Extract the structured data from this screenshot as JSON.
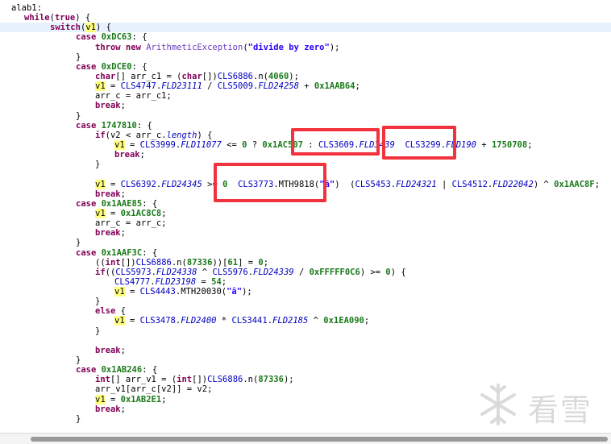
{
  "code_lines": [
    {
      "indent": 1,
      "tokens": [
        [
          "plain",
          "alab1:"
        ]
      ]
    },
    {
      "indent": 3,
      "tokens": [
        [
          "kw",
          "while"
        ],
        [
          "plain",
          "("
        ],
        [
          "kw",
          "true"
        ],
        [
          "plain",
          ") {"
        ]
      ]
    },
    {
      "indent": 7,
      "highlight": true,
      "tokens": [
        [
          "kw",
          "switch"
        ],
        [
          "plain",
          "("
        ],
        [
          "var",
          "v1"
        ],
        [
          "plain",
          ") {"
        ]
      ]
    },
    {
      "indent": 11,
      "tokens": [
        [
          "kw",
          "case "
        ],
        [
          "num",
          "0xDC63"
        ],
        [
          "plain",
          ": {"
        ]
      ]
    },
    {
      "indent": 14,
      "tokens": [
        [
          "kw",
          "throw new "
        ],
        [
          "exc",
          "ArithmeticException"
        ],
        [
          "plain",
          "("
        ],
        [
          "str",
          "\"divide by zero\""
        ],
        [
          "plain",
          ");"
        ]
      ]
    },
    {
      "indent": 11,
      "tokens": [
        [
          "plain",
          "}"
        ]
      ]
    },
    {
      "indent": 11,
      "tokens": [
        [
          "kw",
          "case "
        ],
        [
          "num",
          "0xDCE0"
        ],
        [
          "plain",
          ": {"
        ]
      ]
    },
    {
      "indent": 14,
      "tokens": [
        [
          "kw",
          "char"
        ],
        [
          "plain",
          "[] arr_c1 = ("
        ],
        [
          "kw",
          "char"
        ],
        [
          "plain",
          "[])"
        ],
        [
          "cls",
          "CLS6886"
        ],
        [
          "plain",
          ".n("
        ],
        [
          "num",
          "4060"
        ],
        [
          "plain",
          ");"
        ]
      ]
    },
    {
      "indent": 14,
      "tokens": [
        [
          "var",
          "v1"
        ],
        [
          "plain",
          " = "
        ],
        [
          "cls",
          "CLS4747"
        ],
        [
          "plain",
          "."
        ],
        [
          "fld",
          "FLD23111"
        ],
        [
          "plain",
          " / "
        ],
        [
          "cls",
          "CLS5009"
        ],
        [
          "plain",
          "."
        ],
        [
          "fld",
          "FLD24258"
        ],
        [
          "plain",
          " + "
        ],
        [
          "num",
          "0x1AAB64"
        ],
        [
          "plain",
          ";"
        ]
      ]
    },
    {
      "indent": 14,
      "tokens": [
        [
          "plain",
          "arr_c = arr_c1;"
        ]
      ]
    },
    {
      "indent": 14,
      "tokens": [
        [
          "kw",
          "break"
        ],
        [
          "plain",
          ";"
        ]
      ]
    },
    {
      "indent": 11,
      "tokens": [
        [
          "plain",
          "}"
        ]
      ]
    },
    {
      "indent": 11,
      "tokens": [
        [
          "kw",
          "case "
        ],
        [
          "num",
          "1747810"
        ],
        [
          "plain",
          ": {"
        ]
      ]
    },
    {
      "indent": 14,
      "tokens": [
        [
          "kw",
          "if"
        ],
        [
          "plain",
          "(v2 < arr_c."
        ],
        [
          "fld",
          "length"
        ],
        [
          "plain",
          ") {"
        ]
      ]
    },
    {
      "indent": 17,
      "tokens": [
        [
          "var",
          "v1"
        ],
        [
          "plain",
          " = "
        ],
        [
          "cls",
          "CLS3999"
        ],
        [
          "plain",
          "."
        ],
        [
          "fld",
          "FLD11077"
        ],
        [
          "plain",
          " <= "
        ],
        [
          "num",
          "0"
        ],
        [
          "plain",
          " ? "
        ],
        [
          "num",
          "0x1AC507"
        ],
        [
          "plain",
          " : "
        ],
        [
          "cls",
          "CLS3609"
        ],
        [
          "plain",
          "."
        ],
        [
          "fld",
          "FLD3439"
        ],
        [
          "plain",
          "  "
        ],
        [
          "cls",
          "CLS3299"
        ],
        [
          "plain",
          "."
        ],
        [
          "fld",
          "FLD190"
        ],
        [
          "plain",
          " + "
        ],
        [
          "num",
          "1750708"
        ],
        [
          "plain",
          ";"
        ]
      ]
    },
    {
      "indent": 17,
      "tokens": [
        [
          "kw",
          "break"
        ],
        [
          "plain",
          ";"
        ]
      ]
    },
    {
      "indent": 14,
      "tokens": [
        [
          "plain",
          "}"
        ]
      ]
    },
    {
      "indent": 0,
      "tokens": []
    },
    {
      "indent": 14,
      "tokens": [
        [
          "var",
          "v1"
        ],
        [
          "plain",
          " = "
        ],
        [
          "cls",
          "CLS6392"
        ],
        [
          "plain",
          "."
        ],
        [
          "fld",
          "FLD24345"
        ],
        [
          "plain",
          " >= "
        ],
        [
          "num",
          "0"
        ],
        [
          "plain",
          "  "
        ],
        [
          "cls",
          "CLS3773"
        ],
        [
          "plain",
          ".MTH9818("
        ],
        [
          "str",
          "\"ȃ\""
        ],
        [
          "plain",
          ")  ("
        ],
        [
          "cls",
          "CLS5453"
        ],
        [
          "plain",
          "."
        ],
        [
          "fld",
          "FLD24321"
        ],
        [
          "plain",
          " | "
        ],
        [
          "cls",
          "CLS4512"
        ],
        [
          "plain",
          "."
        ],
        [
          "fld",
          "FLD22042"
        ],
        [
          "plain",
          ") ^ "
        ],
        [
          "num",
          "0x1AAC8F"
        ],
        [
          "plain",
          ";"
        ]
      ]
    },
    {
      "indent": 14,
      "tokens": [
        [
          "kw",
          "break"
        ],
        [
          "plain",
          ";"
        ]
      ]
    },
    {
      "indent": 11,
      "tokens": [
        [
          "kw",
          "case "
        ],
        [
          "num",
          "0x1AAE85"
        ],
        [
          "plain",
          ": {"
        ]
      ]
    },
    {
      "indent": 14,
      "tokens": [
        [
          "var",
          "v1"
        ],
        [
          "plain",
          " = "
        ],
        [
          "num",
          "0x1AC8C8"
        ],
        [
          "plain",
          ";"
        ]
      ]
    },
    {
      "indent": 14,
      "tokens": [
        [
          "plain",
          "arr_c = arr_c;"
        ]
      ]
    },
    {
      "indent": 14,
      "tokens": [
        [
          "kw",
          "break"
        ],
        [
          "plain",
          ";"
        ]
      ]
    },
    {
      "indent": 11,
      "tokens": [
        [
          "plain",
          "}"
        ]
      ]
    },
    {
      "indent": 11,
      "tokens": [
        [
          "kw",
          "case "
        ],
        [
          "num",
          "0x1AAF3C"
        ],
        [
          "plain",
          ": {"
        ]
      ]
    },
    {
      "indent": 14,
      "tokens": [
        [
          "plain",
          "(("
        ],
        [
          "kw",
          "int"
        ],
        [
          "plain",
          "[])"
        ],
        [
          "cls",
          "CLS6886"
        ],
        [
          "plain",
          ".n("
        ],
        [
          "num",
          "87336"
        ],
        [
          "plain",
          "))["
        ],
        [
          "num",
          "61"
        ],
        [
          "plain",
          "] = "
        ],
        [
          "num",
          "0"
        ],
        [
          "plain",
          ";"
        ]
      ]
    },
    {
      "indent": 14,
      "tokens": [
        [
          "kw",
          "if"
        ],
        [
          "plain",
          "(("
        ],
        [
          "cls",
          "CLS5973"
        ],
        [
          "plain",
          "."
        ],
        [
          "fld",
          "FLD24338"
        ],
        [
          "plain",
          " ^ "
        ],
        [
          "cls",
          "CLS5976"
        ],
        [
          "plain",
          "."
        ],
        [
          "fld",
          "FLD24339"
        ],
        [
          "plain",
          " / "
        ],
        [
          "num",
          "0xFFFFF0C6"
        ],
        [
          "plain",
          ") >= "
        ],
        [
          "num",
          "0"
        ],
        [
          "plain",
          ") {"
        ]
      ]
    },
    {
      "indent": 17,
      "tokens": [
        [
          "cls",
          "CLS4777"
        ],
        [
          "plain",
          "."
        ],
        [
          "fld",
          "FLD23198"
        ],
        [
          "plain",
          " = "
        ],
        [
          "num",
          "54"
        ],
        [
          "plain",
          ";"
        ]
      ]
    },
    {
      "indent": 17,
      "tokens": [
        [
          "var",
          "v1"
        ],
        [
          "plain",
          " = "
        ],
        [
          "cls",
          "CLS4443"
        ],
        [
          "plain",
          ".MTH20030("
        ],
        [
          "str",
          "\"ȃ\""
        ],
        [
          "plain",
          ");"
        ]
      ]
    },
    {
      "indent": 14,
      "tokens": [
        [
          "plain",
          "}"
        ]
      ]
    },
    {
      "indent": 14,
      "tokens": [
        [
          "kw",
          "else"
        ],
        [
          "plain",
          " {"
        ]
      ]
    },
    {
      "indent": 17,
      "tokens": [
        [
          "var",
          "v1"
        ],
        [
          "plain",
          " = "
        ],
        [
          "cls",
          "CLS3478"
        ],
        [
          "plain",
          "."
        ],
        [
          "fld",
          "FLD2400"
        ],
        [
          "plain",
          " * "
        ],
        [
          "cls",
          "CLS3441"
        ],
        [
          "plain",
          "."
        ],
        [
          "fld",
          "FLD2185"
        ],
        [
          "plain",
          " ^ "
        ],
        [
          "num",
          "0x1EA090"
        ],
        [
          "plain",
          ";"
        ]
      ]
    },
    {
      "indent": 14,
      "tokens": [
        [
          "plain",
          "}"
        ]
      ]
    },
    {
      "indent": 0,
      "tokens": []
    },
    {
      "indent": 14,
      "tokens": [
        [
          "kw",
          "break"
        ],
        [
          "plain",
          ";"
        ]
      ]
    },
    {
      "indent": 11,
      "tokens": [
        [
          "plain",
          "}"
        ]
      ]
    },
    {
      "indent": 11,
      "tokens": [
        [
          "kw",
          "case "
        ],
        [
          "num",
          "0x1AB246"
        ],
        [
          "plain",
          ": {"
        ]
      ]
    },
    {
      "indent": 14,
      "tokens": [
        [
          "kw",
          "int"
        ],
        [
          "plain",
          "[] arr_v1 = ("
        ],
        [
          "kw",
          "int"
        ],
        [
          "plain",
          "[])"
        ],
        [
          "cls",
          "CLS6886"
        ],
        [
          "plain",
          ".n("
        ],
        [
          "num",
          "87336"
        ],
        [
          "plain",
          ");"
        ]
      ]
    },
    {
      "indent": 14,
      "tokens": [
        [
          "plain",
          "arr_v1[arr_c[v2]] = v2;"
        ]
      ]
    },
    {
      "indent": 14,
      "tokens": [
        [
          "var",
          "v1"
        ],
        [
          "plain",
          " = "
        ],
        [
          "num",
          "0x1AB2E1"
        ],
        [
          "plain",
          ";"
        ]
      ]
    },
    {
      "indent": 14,
      "tokens": [
        [
          "kw",
          "break"
        ],
        [
          "plain",
          ";"
        ]
      ]
    },
    {
      "indent": 11,
      "tokens": [
        [
          "plain",
          "}"
        ]
      ]
    }
  ],
  "watermark": {
    "text": "看雪",
    "icon": "snowflake-logo-icon"
  },
  "colors": {
    "annotation_box": "#f2323c",
    "keyword": "#7f0055",
    "number": "#1a7a1a",
    "class_ref": "#0000c0",
    "string": "#2a00ff",
    "var_highlight": "#ffff80",
    "line_highlight": "#e8f2fe"
  }
}
